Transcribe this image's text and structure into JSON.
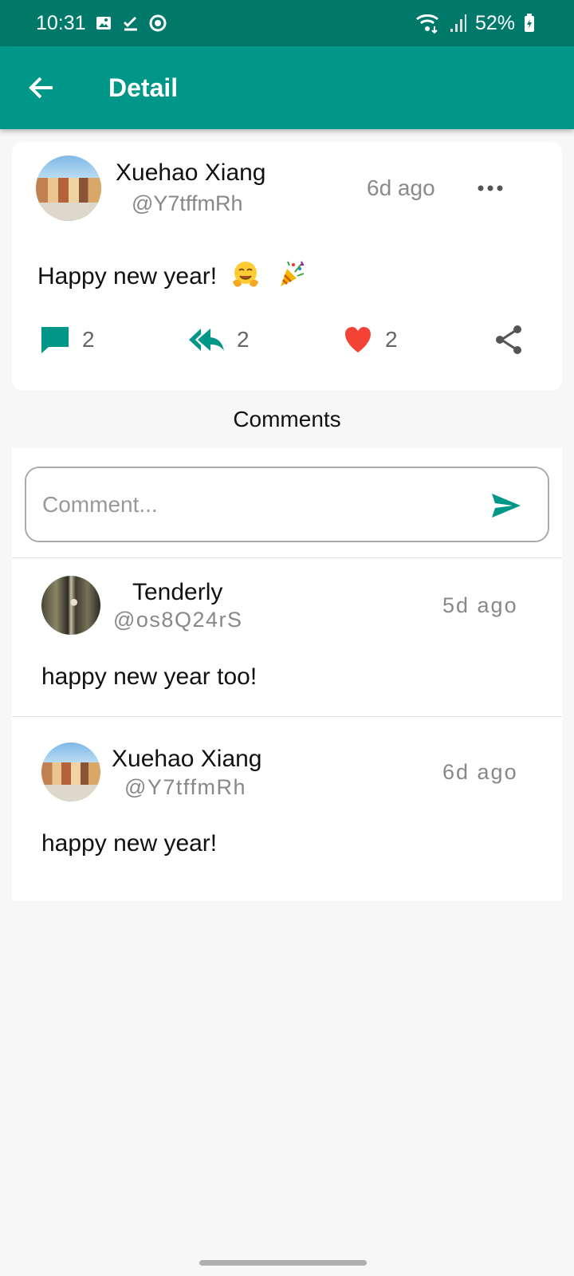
{
  "status_bar": {
    "time": "10:31",
    "battery": "52%",
    "icons": [
      "image-icon",
      "check-icon",
      "record-icon",
      "wifi-icon",
      "signal-icon",
      "battery-icon"
    ]
  },
  "app_bar": {
    "title": "Detail",
    "back_icon": "arrow-left-icon"
  },
  "post": {
    "author_name": "Xuehao Xiang",
    "author_handle": "@Y7tffmRh",
    "time": "6d ago",
    "text": "Happy new year!",
    "emojis": [
      "hugging-face-emoji",
      "party-popper-emoji"
    ],
    "actions": {
      "comments": "2",
      "replies": "2",
      "likes": "2",
      "share_icon": "share-icon"
    }
  },
  "comments": {
    "heading": "Comments",
    "input_placeholder": "Comment...",
    "items": [
      {
        "name": "Tenderly",
        "handle": "@os8Q24rS",
        "time": "5d ago",
        "text": "happy new year too!"
      },
      {
        "name": "Xuehao Xiang",
        "handle": "@Y7tffmRh",
        "time": "6d ago",
        "text": "happy new year!"
      }
    ]
  },
  "colors": {
    "status_bar": "#00796b",
    "app_bar": "#009688",
    "accent": "#009688",
    "heart": "#f44336"
  }
}
